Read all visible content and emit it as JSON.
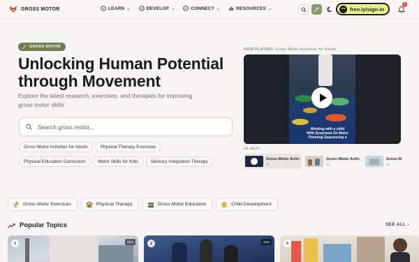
{
  "brand": {
    "name": "GROSS MOTOR"
  },
  "nav": {
    "items": [
      {
        "label": "LEARN"
      },
      {
        "label": "DEVELOP"
      },
      {
        "label": "CONNECT"
      },
      {
        "label": "RESOURCES"
      }
    ],
    "signin_label": "fren.ly/sign-in",
    "notification_count": "1"
  },
  "hero": {
    "tag": "GROSS MOTOR",
    "title": "Unlocking Human Potential through Movement",
    "subtitle": "Explore the latest research, exercises, and therapies for improving gross motor skills",
    "search_placeholder": "Search gross motor...",
    "chips": [
      "Gross Motor Activities for Adults",
      "Physical Therapy Exercises",
      "Physical Education Curriculum",
      "Motor Skills for Kids",
      "Sensory Integration Therapy"
    ]
  },
  "player": {
    "now_playing_label": "NOW PLAYING",
    "now_playing_title": "Gross Motor Activities for Adults",
    "caption": "Working with a child With Dyspraxia On Motor Planning Sequencing a",
    "up_next_label": "UP NEXT",
    "queue": [
      {
        "title": "Gross Motor Activities",
        "num": "#1"
      },
      {
        "title": "Gross Motor Activities",
        "num": "#2"
      },
      {
        "title": "Gross Motor Sk",
        "num": "#3"
      }
    ]
  },
  "categories": [
    {
      "label": "Gross Motor Exercises",
      "icon": "figure-icon"
    },
    {
      "label": "Physical Therapy",
      "icon": "clinic-icon"
    },
    {
      "label": "Gross Motor Education",
      "icon": "books-icon"
    },
    {
      "label": "Child Development",
      "icon": "child-face-icon"
    }
  ],
  "popular": {
    "title": "Popular Topics",
    "see_all": "SEE ALL",
    "cards": [
      {
        "num": "1",
        "score": "8/10"
      },
      {
        "num": "2",
        "score": "8/10"
      },
      {
        "num": "3",
        "score": ""
      }
    ]
  },
  "colors": {
    "accent": "#6f7d55",
    "signin_bg": "#e6f28a",
    "badge": "#e03b2b",
    "background": "#f6f5f2"
  }
}
